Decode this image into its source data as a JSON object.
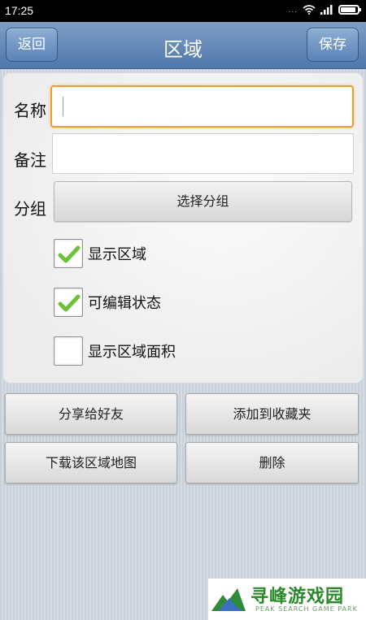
{
  "status_bar": {
    "time": "17:25",
    "dots": "...",
    "battery_level": 0.8
  },
  "header": {
    "title": "区域",
    "back_label": "返回",
    "save_label": "保存"
  },
  "form": {
    "name_label": "名称",
    "name_value": "",
    "note_label": "备注",
    "note_value": "",
    "group_label": "分组",
    "choose_group_label": "选择分组"
  },
  "checkboxes": [
    {
      "label": "显示区域",
      "checked": true
    },
    {
      "label": "可编辑状态",
      "checked": true
    },
    {
      "label": "显示区域面积",
      "checked": false
    }
  ],
  "actions": {
    "share": "分享给好友",
    "favorite": "添加到收藏夹",
    "download": "下载该区域地图",
    "delete": "删除"
  },
  "watermark": {
    "name": "寻峰游戏园",
    "sub": "PEAK SEARCH GAME PARK"
  },
  "colors": {
    "title_bar": "#5f86b8",
    "focus_border": "#f39b2b",
    "check_mark": "#6ec23a",
    "watermark_green": "#2a8a2a"
  }
}
